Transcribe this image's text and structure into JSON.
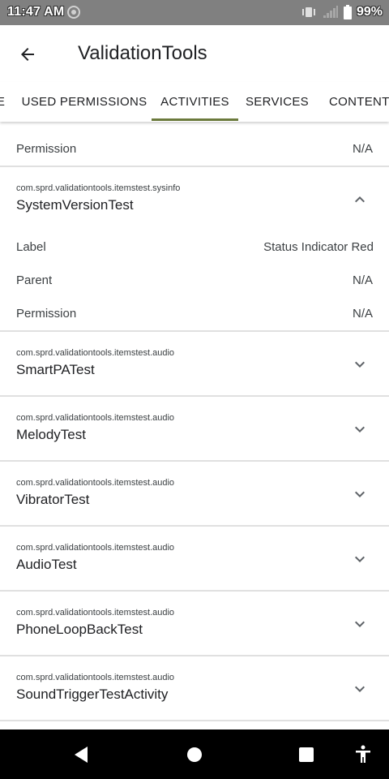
{
  "status_bar": {
    "time": "11:47 AM",
    "battery": "99%"
  },
  "app_bar": {
    "title": "ValidationTools"
  },
  "tabs": [
    {
      "label": "E"
    },
    {
      "label": "USED PERMISSIONS"
    },
    {
      "label": "ACTIVITIES",
      "selected": true
    },
    {
      "label": "SERVICES"
    },
    {
      "label": "CONTENT P"
    }
  ],
  "accent_color": "#6b7a3c",
  "top_detail": {
    "permission_label": "Permission",
    "permission_value": "N/A"
  },
  "expanded_activity": {
    "package": "com.sprd.validationtools.itemstest.sysinfo",
    "name": "SystemVersionTest",
    "details": [
      {
        "label": "Label",
        "value": "Status Indicator Red"
      },
      {
        "label": "Parent",
        "value": "N/A"
      },
      {
        "label": "Permission",
        "value": "N/A"
      }
    ]
  },
  "activities": [
    {
      "package": "com.sprd.validationtools.itemstest.audio",
      "name": "SmartPATest"
    },
    {
      "package": "com.sprd.validationtools.itemstest.audio",
      "name": "MelodyTest"
    },
    {
      "package": "com.sprd.validationtools.itemstest.audio",
      "name": "VibratorTest"
    },
    {
      "package": "com.sprd.validationtools.itemstest.audio",
      "name": "AudioTest"
    },
    {
      "package": "com.sprd.validationtools.itemstest.audio",
      "name": "PhoneLoopBackTest"
    },
    {
      "package": "com.sprd.validationtools.itemstest.audio",
      "name": "SoundTriggerTestActivity"
    }
  ],
  "icons": {
    "back": "arrow-left-icon",
    "collapse": "chevron-up-icon",
    "expand": "chevron-down-icon",
    "nav_back": "triangle-back-icon",
    "nav_home": "circle-home-icon",
    "nav_recents": "square-recents-icon",
    "accessibility": "accessibility-icon"
  }
}
